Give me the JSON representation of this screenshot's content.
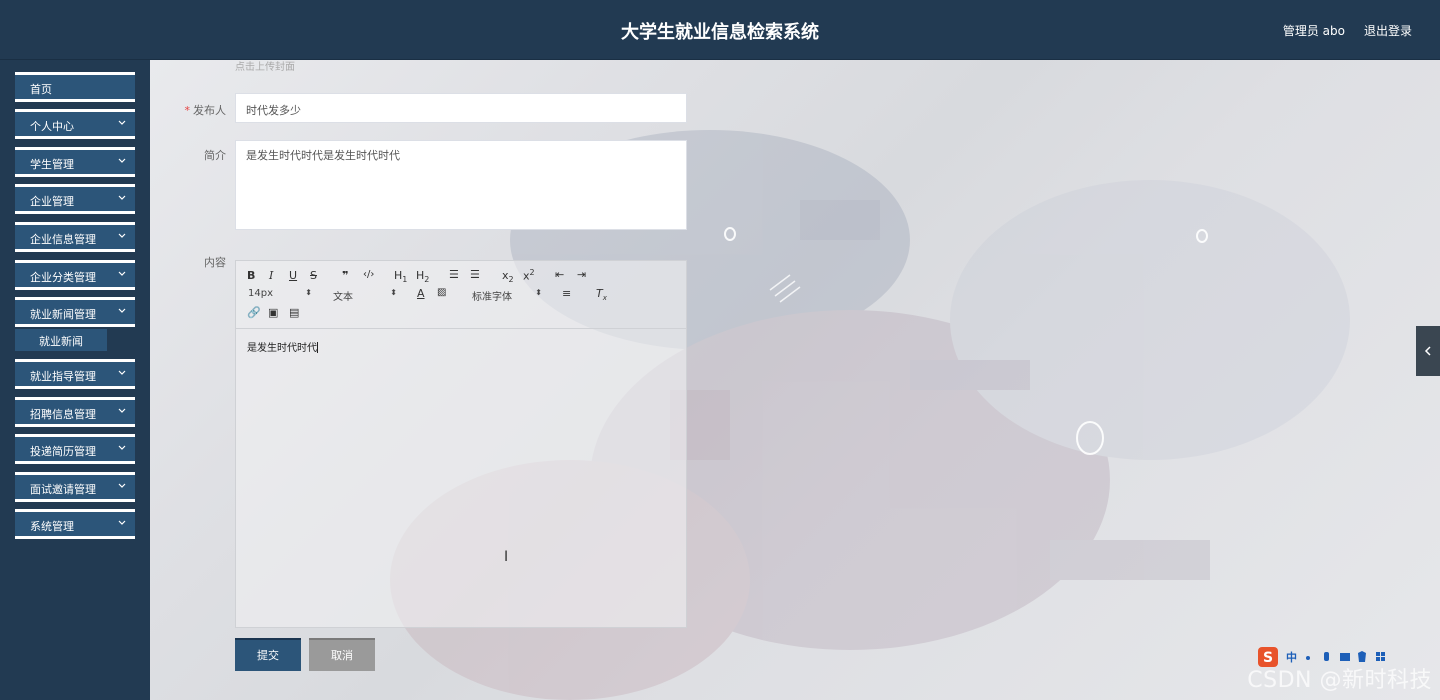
{
  "header": {
    "title": "大学生就业信息检索系统",
    "user_label": "管理员 abo",
    "logout_label": "退出登录"
  },
  "sidebar": {
    "items": [
      {
        "label": "首页",
        "has_arrow": false
      },
      {
        "label": "个人中心",
        "has_arrow": true
      },
      {
        "label": "学生管理",
        "has_arrow": true
      },
      {
        "label": "企业管理",
        "has_arrow": true
      },
      {
        "label": "企业信息管理",
        "has_arrow": true
      },
      {
        "label": "企业分类管理",
        "has_arrow": true
      },
      {
        "label": "就业新闻管理",
        "has_arrow": true,
        "expanded": true
      },
      {
        "label": "就业指导管理",
        "has_arrow": true
      },
      {
        "label": "招聘信息管理",
        "has_arrow": true
      },
      {
        "label": "投递简历管理",
        "has_arrow": true
      },
      {
        "label": "面试邀请管理",
        "has_arrow": true
      },
      {
        "label": "系统管理",
        "has_arrow": true
      }
    ],
    "subitem": {
      "label": "就业新闻"
    }
  },
  "form": {
    "upload_hint": "点击上传封面",
    "publisher": {
      "label": "发布人",
      "required": true,
      "value": "时代发多少"
    },
    "summary": {
      "label": "简介",
      "value": "是发生时代时代是发生时代时代"
    },
    "content": {
      "label": "内容",
      "value": "是发生时代时代",
      "toolbar": {
        "font_size": "14px",
        "paragraph": "文本",
        "font_family": "标准字体"
      }
    },
    "submit_label": "提交",
    "cancel_label": "取消"
  },
  "watermark": "CSDN @新时科技",
  "colors": {
    "header_bg": "#223a52",
    "menu_bg": "#2c5579",
    "submit_bg": "#2c5579",
    "cancel_bg": "#9a9a9a",
    "required": "#e64242"
  }
}
